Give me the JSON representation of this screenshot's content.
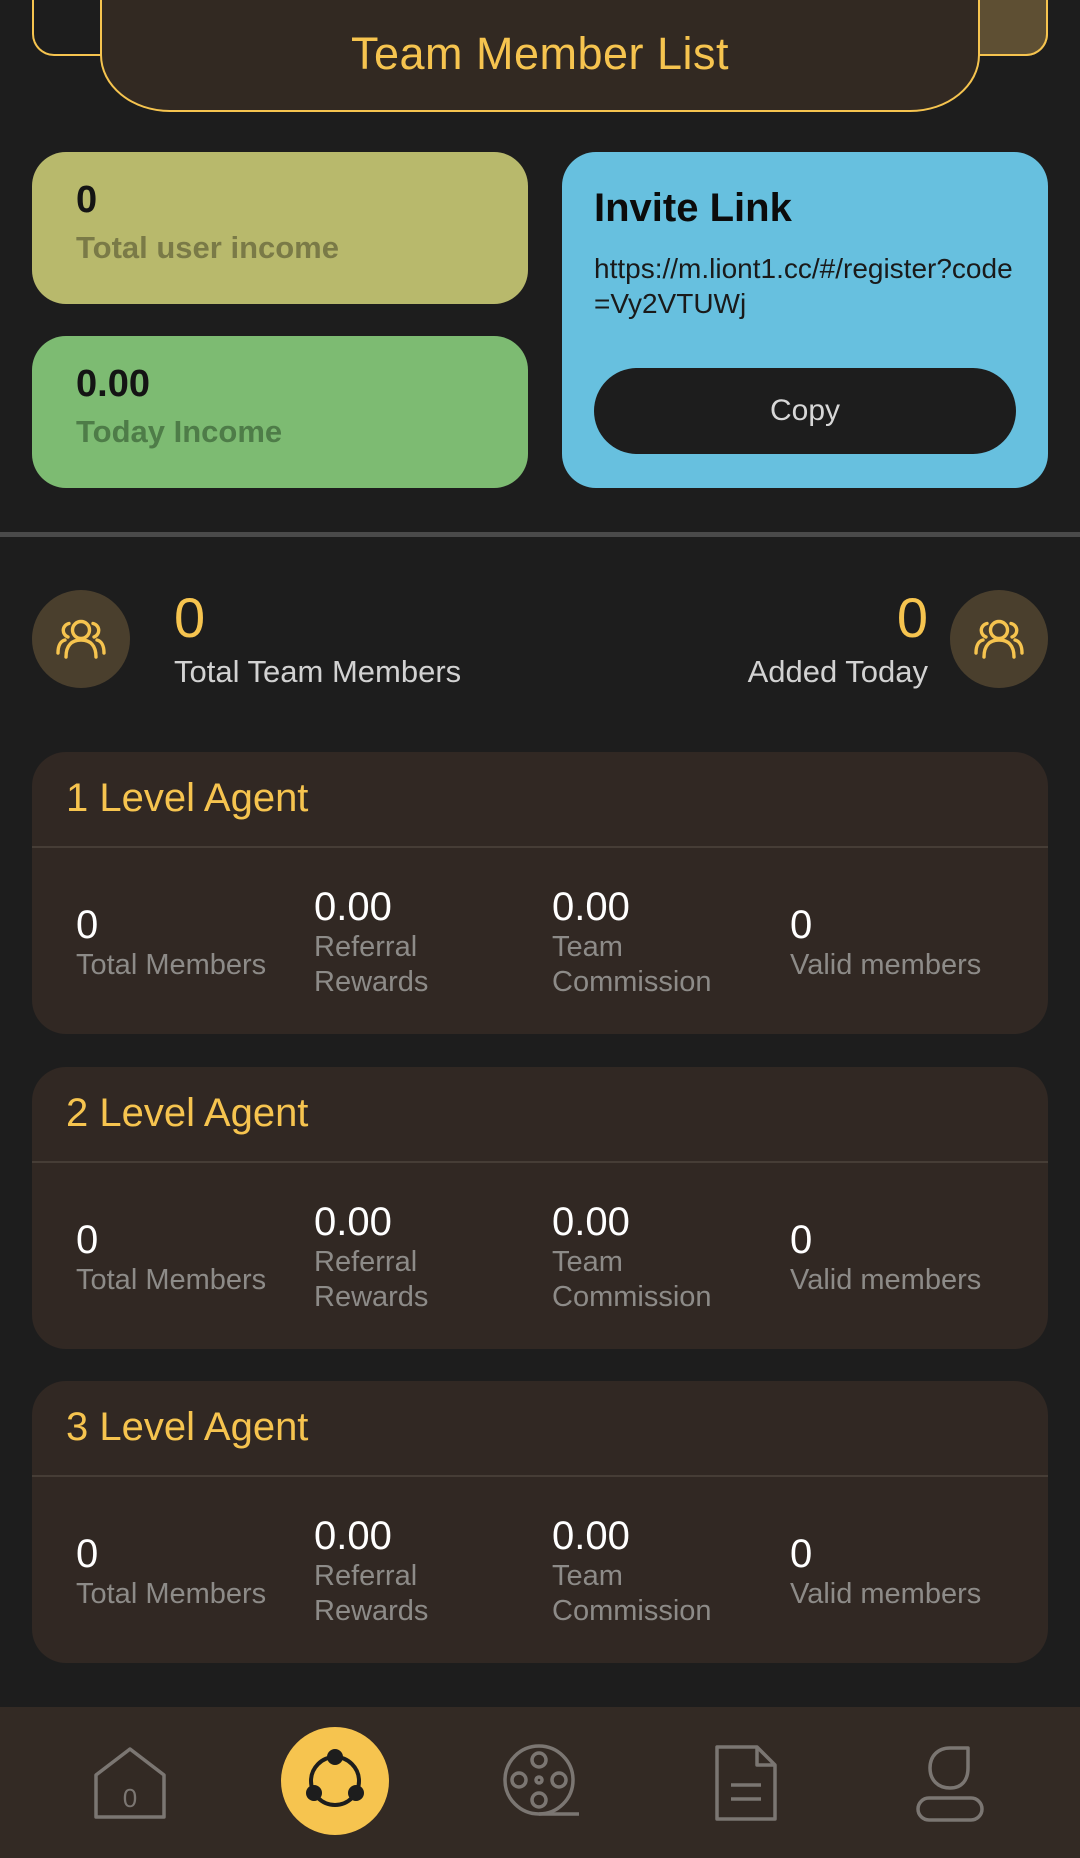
{
  "header": {
    "title": "Team Member List"
  },
  "income": {
    "total_user_income": {
      "value": "0",
      "label": "Total user income"
    },
    "today_income": {
      "value": "0.00",
      "label": "Today Income"
    }
  },
  "invite": {
    "title": "Invite Link",
    "url": "https://m.liont1.cc/#/register?code=Vy2VTUWj",
    "copy_label": "Copy"
  },
  "team_stats": {
    "total_members": {
      "value": "0",
      "label": "Total Team Members"
    },
    "added_today": {
      "value": "0",
      "label": "Added Today"
    }
  },
  "levels": [
    {
      "title": "1 Level Agent",
      "metrics": [
        {
          "value": "0",
          "label": "Total Members"
        },
        {
          "value": "0.00",
          "label": "Referral Rewards"
        },
        {
          "value": "0.00",
          "label": "Team Commission"
        },
        {
          "value": "0",
          "label": "Valid members"
        }
      ]
    },
    {
      "title": "2 Level Agent",
      "metrics": [
        {
          "value": "0",
          "label": "Total Members"
        },
        {
          "value": "0.00",
          "label": "Referral Rewards"
        },
        {
          "value": "0.00",
          "label": "Team Commission"
        },
        {
          "value": "0",
          "label": "Valid members"
        }
      ]
    },
    {
      "title": "3 Level Agent",
      "metrics": [
        {
          "value": "0",
          "label": "Total Members"
        },
        {
          "value": "0.00",
          "label": "Referral Rewards"
        },
        {
          "value": "0.00",
          "label": "Team Commission"
        },
        {
          "value": "0",
          "label": "Valid members"
        }
      ]
    }
  ],
  "nav": {
    "items": [
      {
        "icon": "home-icon",
        "badge": "0",
        "active": false
      },
      {
        "icon": "team-share-icon",
        "active": true
      },
      {
        "icon": "film-reel-icon",
        "active": false
      },
      {
        "icon": "document-icon",
        "active": false
      },
      {
        "icon": "profile-icon",
        "active": false
      }
    ]
  },
  "colors": {
    "accent": "#f6c44f",
    "background": "#1d1d1d",
    "card": "#312823",
    "total_income_card": "#b8b96c",
    "today_income_card": "#7dbb72",
    "invite_card": "#67c0df"
  }
}
